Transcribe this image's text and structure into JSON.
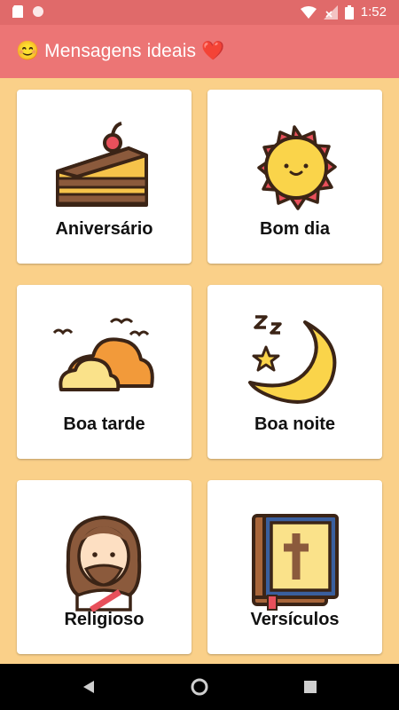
{
  "status_bar": {
    "time": "1:52",
    "left_icons": [
      "sd-card-icon",
      "circle-notification-icon"
    ],
    "right_icons": [
      "wifi-icon",
      "signal-icon",
      "battery-icon"
    ]
  },
  "app_bar": {
    "title": "😊 Mensagens ideais ❤️"
  },
  "cards": [
    {
      "label": "Aniversário",
      "icon": "cake-icon"
    },
    {
      "label": "Bom dia",
      "icon": "sun-icon"
    },
    {
      "label": "Boa tarde",
      "icon": "cloud-sunset-icon"
    },
    {
      "label": "Boa noite",
      "icon": "moon-stars-icon"
    },
    {
      "label": "Religioso",
      "icon": "jesus-icon"
    },
    {
      "label": "Versículos",
      "icon": "bible-icon"
    }
  ],
  "nav_bar": {
    "icons": [
      "back-icon",
      "home-icon",
      "recents-icon"
    ]
  },
  "colors": {
    "status_bar": "#E06A6A",
    "app_bar": "#EC7575",
    "background": "#FAD089",
    "card": "#FFFFFF"
  }
}
